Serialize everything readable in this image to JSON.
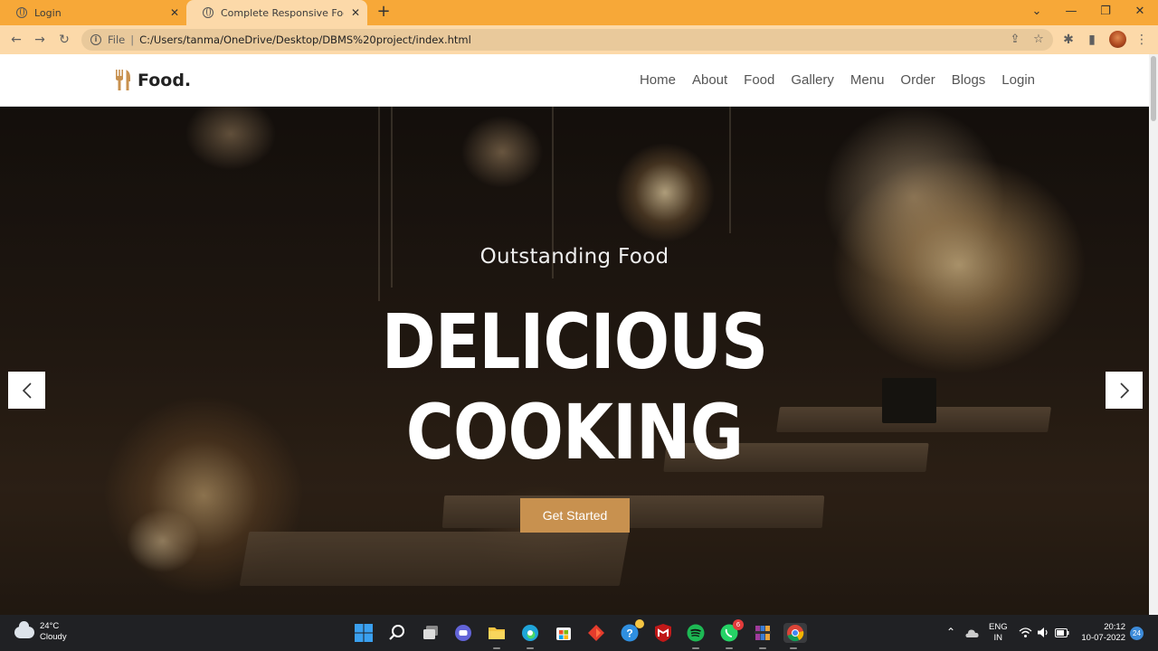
{
  "browser": {
    "tabs": [
      {
        "title": "Login",
        "active": false
      },
      {
        "title": "Complete Responsive Food / Res",
        "active": true
      }
    ],
    "new_tab_label": "+",
    "address": {
      "scheme": "File",
      "separator": "|",
      "url": "C:/Users/tanma/OneDrive/Desktop/DBMS%20project/index.html"
    }
  },
  "site": {
    "logo_text": "Food.",
    "nav": [
      "Home",
      "About",
      "Food",
      "Gallery",
      "Menu",
      "Order",
      "Blogs",
      "Login"
    ],
    "hero": {
      "subtitle": "Outstanding Food",
      "title_line1": "DELICIOUS",
      "title_line2": "COOKING",
      "cta_label": "Get Started"
    },
    "accent_color": "#c8914f"
  },
  "taskbar": {
    "weather": {
      "temp": "24°C",
      "condition": "Cloudy"
    },
    "lang": {
      "line1": "ENG",
      "line2": "IN"
    },
    "clock": {
      "time": "20:12",
      "date": "10-07-2022"
    },
    "notification_count": "24",
    "whatsapp_badge": "6",
    "apps": [
      "start-icon",
      "search-icon",
      "task-view-icon",
      "teams-chat-icon",
      "file-explorer-icon",
      "edge-icon",
      "store-icon",
      "office-icon",
      "chatapp-icon",
      "mcafee-icon",
      "spotify-icon",
      "whatsapp-icon",
      "winrar-icon",
      "chrome-icon"
    ]
  }
}
